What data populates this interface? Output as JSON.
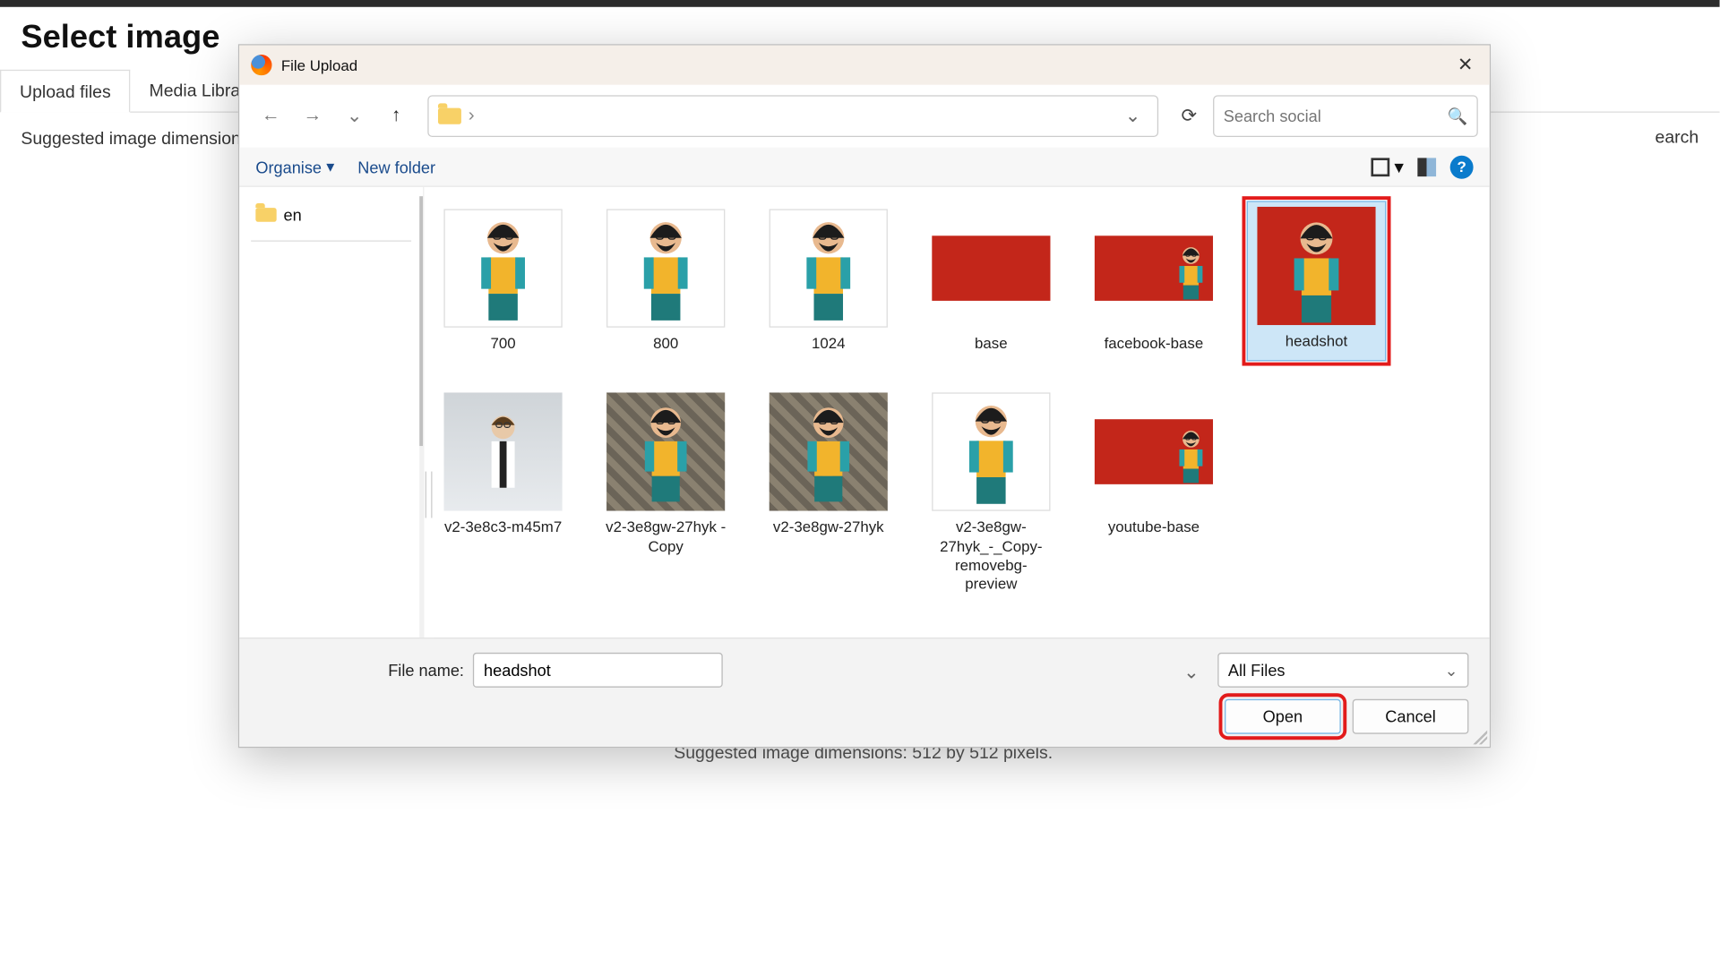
{
  "page": {
    "title": "Select image",
    "tabs": {
      "upload": "Upload files",
      "library": "Media Library"
    },
    "suggested_prefix": "Suggested image dimensions",
    "search_fragment": "earch",
    "bottom_text": "Suggested image dimensions: 512 by 512 pixels."
  },
  "dialog": {
    "title": "File Upload",
    "breadcrumb_sep": "›",
    "search_placeholder": "Search social",
    "toolbar": {
      "organise": "Organise",
      "new_folder": "New folder"
    },
    "sidebar": {
      "folder": "en"
    },
    "files": [
      {
        "name": "700"
      },
      {
        "name": "800"
      },
      {
        "name": "1024"
      },
      {
        "name": "base"
      },
      {
        "name": "facebook-base"
      },
      {
        "name": "headshot"
      },
      {
        "name": "v2-3e8c3-m45m7"
      },
      {
        "name": "v2-3e8gw-27hyk - Copy"
      },
      {
        "name": "v2-3e8gw-27hyk"
      },
      {
        "name": "v2-3e8gw-27hyk_-_Copy-removebg-preview"
      },
      {
        "name": "youtube-base"
      }
    ],
    "footer": {
      "filename_label": "File name:",
      "filename_value": "headshot",
      "filter": "All Files",
      "open": "Open",
      "cancel": "Cancel"
    }
  }
}
